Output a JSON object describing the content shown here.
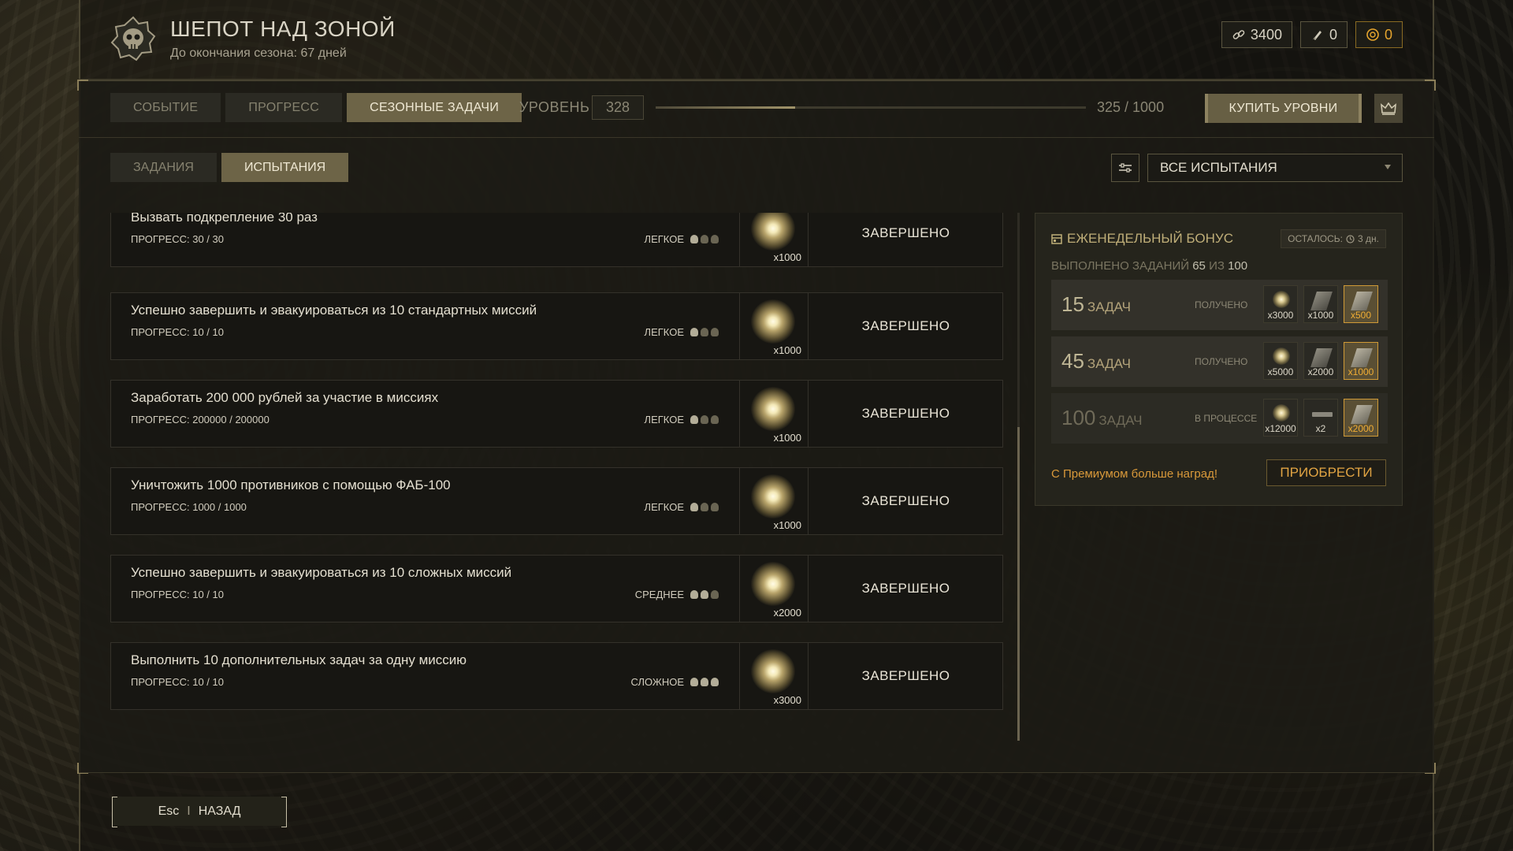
{
  "header": {
    "title": "ШЕПОТ НАД ЗОНОЙ",
    "subtitle": "До окончания сезона: 67 дней",
    "emblem_icon": "skull-emblem-icon"
  },
  "currencies": [
    {
      "icon": "chain-icon",
      "value": "3400"
    },
    {
      "icon": "rocket-icon",
      "value": "0"
    },
    {
      "icon": "gold-coin-icon",
      "value": "0",
      "color": "#e6a52e"
    }
  ],
  "main_tabs": [
    "СОБЫТИЕ",
    "ПРОГРЕСС",
    "СЕЗОННЫЕ ЗАДАЧИ"
  ],
  "active_main_tab": "СЕЗОННЫЕ ЗАДАЧИ",
  "level": {
    "label": "УРОВЕНЬ",
    "value": "328",
    "progress_text": "325 / 1000",
    "progress_fraction": 0.325,
    "buy_label": "КУПИТЬ УРОВНИ",
    "crown_icon": "crown-icon"
  },
  "sub_tabs": [
    "ЗАДАНИЯ",
    "ИСПЫТАНИЯ"
  ],
  "active_sub_tab": "ИСПЫТАНИЯ",
  "filter": {
    "icon": "sliders-icon",
    "selected": "ВСЕ ИСПЫТАНИЯ"
  },
  "tasks": [
    {
      "name": "Вызвать подкрепление 30 раз",
      "progress": "ПРОГРЕСС: 30 / 30",
      "difficulty": "ЛЕГКОЕ",
      "skulls": 1,
      "reward_qty": "x1000",
      "status": "ЗАВЕРШЕНО"
    },
    {
      "name": "Успешно завершить и эвакуироваться из 10 стандартных миссий",
      "progress": "ПРОГРЕСС: 10 / 10",
      "difficulty": "ЛЕГКОЕ",
      "skulls": 1,
      "reward_qty": "x1000",
      "status": "ЗАВЕРШЕНО"
    },
    {
      "name": "Заработать 200 000 рублей за участие в миссиях",
      "progress": "ПРОГРЕСС: 200000 / 200000",
      "difficulty": "ЛЕГКОЕ",
      "skulls": 1,
      "reward_qty": "x1000",
      "status": "ЗАВЕРШЕНО"
    },
    {
      "name": "Уничтожить 1000 противников с помощью ФАБ-100",
      "progress": "ПРОГРЕСС: 1000 / 1000",
      "difficulty": "ЛЕГКОЕ",
      "skulls": 1,
      "reward_qty": "x1000",
      "status": "ЗАВЕРШЕНО"
    },
    {
      "name": "Успешно завершить и эвакуироваться из 10 сложных миссий",
      "progress": "ПРОГРЕСС: 10 / 10",
      "difficulty": "СРЕДНЕЕ",
      "skulls": 2,
      "reward_qty": "x2000",
      "status": "ЗАВЕРШЕНО"
    },
    {
      "name": "Выполнить 10 дополнительных задач за одну миссию",
      "progress": "ПРОГРЕСС: 10 / 10",
      "difficulty": "СЛОЖНОЕ",
      "skulls": 3,
      "reward_qty": "x3000",
      "status": "ЗАВЕРШЕНО"
    }
  ],
  "weekly_bonus": {
    "title": "ЕЖЕНЕДЕЛЬНЫЙ БОНУС",
    "time_left_label": "ОСТАЛОСЬ:",
    "time_left_value": "3 дн.",
    "done_prefix": "ВЫПОЛНЕНО ЗАДАНИЙ",
    "done_count": "65",
    "done_mid": "ИЗ",
    "done_total": "100",
    "tiers": [
      {
        "count": "15",
        "label": "ЗАДАЧ",
        "state": "ПОЛУЧЕНО",
        "rewards": [
          "x3000",
          "x1000",
          "x500"
        ]
      },
      {
        "count": "45",
        "label": "ЗАДАЧ",
        "state": "ПОЛУЧЕНО",
        "rewards": [
          "x5000",
          "x2000",
          "x1000"
        ]
      },
      {
        "count": "100",
        "label": "ЗАДАЧ",
        "state": "В ПРОЦЕССЕ",
        "rewards": [
          "x12000",
          "x2",
          "x2000"
        ]
      }
    ],
    "promo": "С Премиумом больше наград!",
    "acquire_label": "ПРИОБРЕСТИ"
  },
  "footer": {
    "key": "Esc",
    "separator": "I",
    "back_label": "НАЗАД"
  }
}
